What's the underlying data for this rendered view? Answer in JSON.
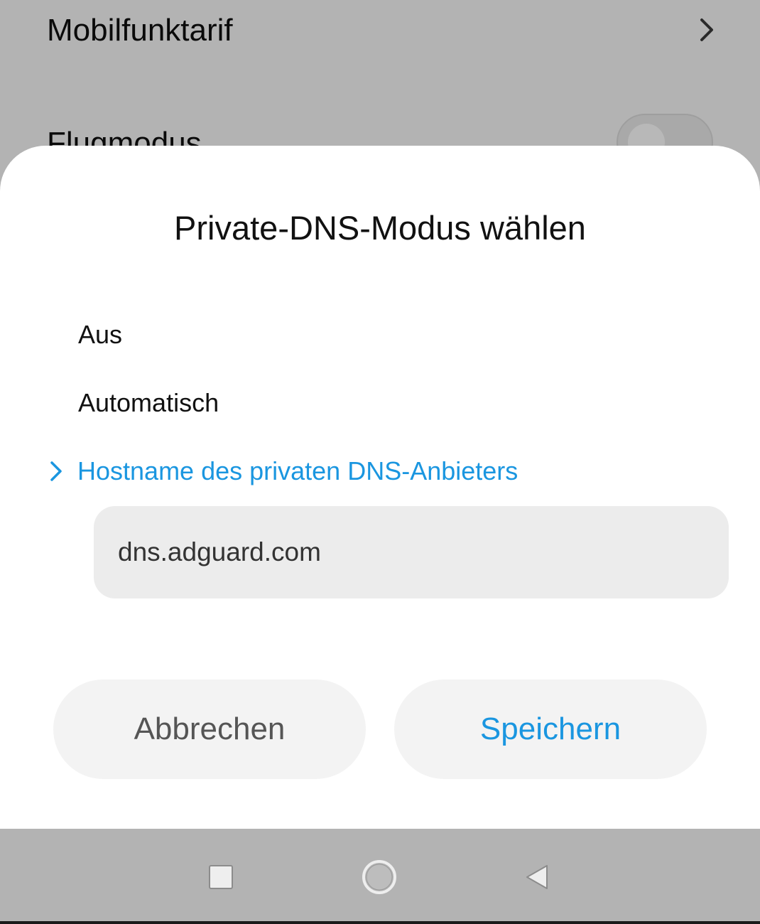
{
  "background": {
    "rows": [
      {
        "label": "Mobilfunktarif",
        "icon": "chevron-right-icon"
      },
      {
        "label": "Flugmodus",
        "toggle_on": false
      }
    ]
  },
  "dialog": {
    "title": "Private-DNS-Modus wählen",
    "options": [
      {
        "label": "Aus",
        "selected": false
      },
      {
        "label": "Automatisch",
        "selected": false
      },
      {
        "label": "Hostname des privaten DNS-Anbieters",
        "selected": true
      }
    ],
    "hostname": {
      "value": "dns.adguard.com"
    },
    "buttons": {
      "cancel": "Abbrechen",
      "save": "Speichern"
    }
  },
  "navbar": {
    "icons": [
      "recents-icon",
      "home-icon",
      "back-icon"
    ]
  },
  "colors": {
    "accent": "#1a96e0",
    "dim_background": "#b3b3b3",
    "sheet": "#ffffff",
    "input_background": "#ececec",
    "button_background": "#f3f3f3"
  }
}
